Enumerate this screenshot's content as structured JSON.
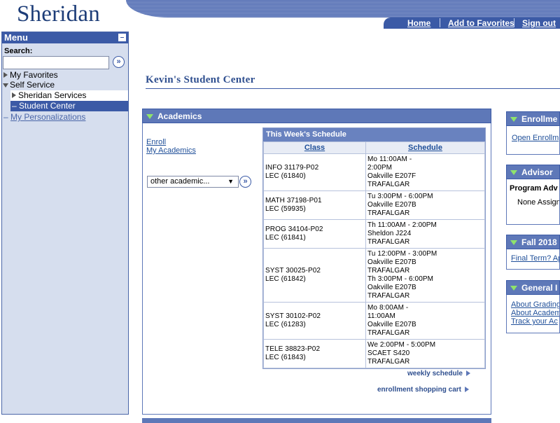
{
  "header": {
    "logo": "Sheridan",
    "nav": {
      "home": "Home",
      "favorites": "Add to Favorites",
      "signout": "Sign out"
    }
  },
  "menu": {
    "title": "Menu",
    "search_label": "Search:",
    "go_icon": "»",
    "items": [
      {
        "label": "My Favorites"
      },
      {
        "label": "Self Service"
      },
      {
        "label": "Sheridan Services"
      },
      {
        "label": "Student Center",
        "prefix": "–"
      },
      {
        "label": "My Personalizations",
        "prefix": "–"
      }
    ]
  },
  "page": {
    "title": "Kevin's Student Center"
  },
  "academics": {
    "header": "Academics",
    "links": {
      "enroll": "Enroll",
      "my_academics": "My Academics"
    },
    "other_select": "other academic...",
    "select_arrow": "▼",
    "schedule": {
      "title": "This Week's Schedule",
      "columns": [
        "Class",
        "Schedule"
      ],
      "rows": [
        {
          "class": "INFO 31179-P02\nLEC (61840)",
          "schedule": "Mo 11:00AM -\n2:00PM\nOakville E207F\nTRAFALGAR"
        },
        {
          "class": "MATH 37198-P01\nLEC (59935)",
          "schedule": "Tu 3:00PM - 6:00PM\nOakville E207B\nTRAFALGAR"
        },
        {
          "class": "PROG 34104-P02\nLEC (61841)",
          "schedule": "Th 11:00AM - 2:00PM\nSheldon J224\nTRAFALGAR"
        },
        {
          "class": "SYST 30025-P02\nLEC (61842)",
          "schedule": "Tu 12:00PM - 3:00PM\nOakville E207B\nTRAFALGAR\nTh 3:00PM - 6:00PM\nOakville E207B\nTRAFALGAR"
        },
        {
          "class": "SYST 30102-P02\nLEC (61283)",
          "schedule": "Mo 8:00AM -\n11:00AM\nOakville E207B\nTRAFALGAR"
        },
        {
          "class": "TELE 38823-P02\nLEC (61843)",
          "schedule": "We 2:00PM - 5:00PM\nSCAET S420\nTRAFALGAR"
        }
      ]
    },
    "weekly_schedule": "weekly schedule",
    "shopping_cart": "enrollment shopping cart"
  },
  "right": {
    "enrollment": {
      "header": "Enrollme",
      "link": "Open Enrollm"
    },
    "advisor": {
      "header": "Advisor",
      "program": "Program Adv",
      "none": "None Assign"
    },
    "fall": {
      "header": "Fall 2018",
      "link": "Final Term? Ap"
    },
    "general": {
      "header": "General I",
      "links": [
        "About Grading",
        "About Academ",
        "Track your Ac"
      ]
    }
  }
}
